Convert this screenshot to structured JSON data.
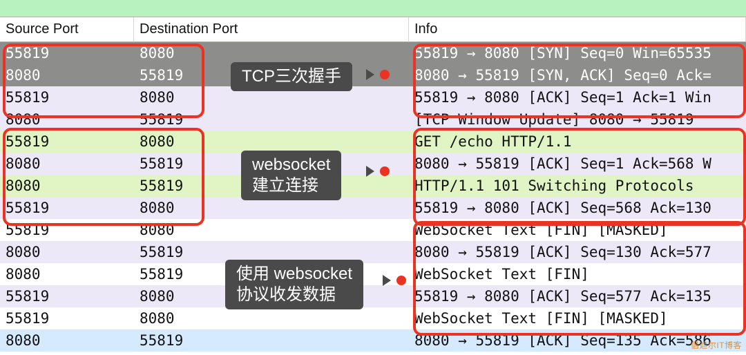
{
  "header": {
    "src": "Source Port",
    "dst": "Destination Port",
    "info": "Info"
  },
  "rows": [
    {
      "src": "55819",
      "dst": "8080",
      "info": "55819 → 8080 [SYN] Seq=0 Win=65535",
      "bg": "bg-sel"
    },
    {
      "src": "8080",
      "dst": "55819",
      "info": "8080 → 55819 [SYN, ACK] Seq=0 Ack=",
      "bg": "bg-sel"
    },
    {
      "src": "55819",
      "dst": "8080",
      "info": "55819 → 8080 [ACK] Seq=1 Ack=1 Win",
      "bg": "bg-alt1"
    },
    {
      "src": "8080",
      "dst": "55819",
      "info": "[TCP Window Update] 8080 → 55819 ",
      "bg": "bg-alt1"
    },
    {
      "src": "55819",
      "dst": "8080",
      "info": "GET /echo HTTP/1.1",
      "bg": "bg-hl"
    },
    {
      "src": "8080",
      "dst": "55819",
      "info": "8080 → 55819 [ACK] Seq=1 Ack=568 W",
      "bg": "bg-alt1"
    },
    {
      "src": "8080",
      "dst": "55819",
      "info": "HTTP/1.1 101 Switching Protocols",
      "bg": "bg-hl"
    },
    {
      "src": "55819",
      "dst": "8080",
      "info": "55819 → 8080 [ACK] Seq=568 Ack=130",
      "bg": "bg-alt1"
    },
    {
      "src": "55819",
      "dst": "8080",
      "info": "WebSocket Text [FIN] [MASKED]",
      "bg": "bg-alt0"
    },
    {
      "src": "8080",
      "dst": "55819",
      "info": "8080 → 55819 [ACK] Seq=130 Ack=577",
      "bg": "bg-alt1"
    },
    {
      "src": "8080",
      "dst": "55819",
      "info": "WebSocket Text [FIN]",
      "bg": "bg-alt0"
    },
    {
      "src": "55819",
      "dst": "8080",
      "info": "55819 → 8080 [ACK] Seq=577 Ack=135",
      "bg": "bg-alt1"
    },
    {
      "src": "55819",
      "dst": "8080",
      "info": "WebSocket Text [FIN] [MASKED]",
      "bg": "bg-alt0"
    },
    {
      "src": "8080",
      "dst": "55819",
      "info": "8080 → 55819 [ACK] Seq=135 Ack=586",
      "bg": "bg-blue"
    }
  ],
  "callouts": {
    "c1": "TCP三次握手",
    "c2a": "websocket",
    "c2b": "建立连接",
    "c3a": "使用 websocket",
    "c3b": "协议收发数据"
  },
  "watermark": "倡遮尔IT博客"
}
